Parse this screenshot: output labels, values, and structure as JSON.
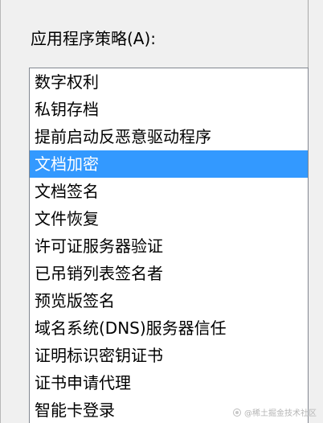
{
  "policy": {
    "label": "应用程序策略(A):",
    "items": [
      {
        "label": "数字权利"
      },
      {
        "label": "私钥存档"
      },
      {
        "label": "提前启动反恶意驱动程序"
      },
      {
        "label": "文档加密"
      },
      {
        "label": "文档签名"
      },
      {
        "label": "文件恢复"
      },
      {
        "label": "许可证服务器验证"
      },
      {
        "label": "已吊销列表签名者"
      },
      {
        "label": "预览版签名"
      },
      {
        "label": "域名系统(DNS)服务器信任"
      },
      {
        "label": "证明标识密钥证书"
      },
      {
        "label": "证书申请代理"
      },
      {
        "label": "智能卡登录"
      }
    ],
    "selected_label": "文档加密"
  },
  "watermark": {
    "text": "@稀土掘金技术社区",
    "icon": "juejin-logo-icon"
  },
  "colors": {
    "selection": "#3399ff",
    "background": "#f0f0f0",
    "list_background": "#ffffff",
    "list_border": "#828790"
  }
}
